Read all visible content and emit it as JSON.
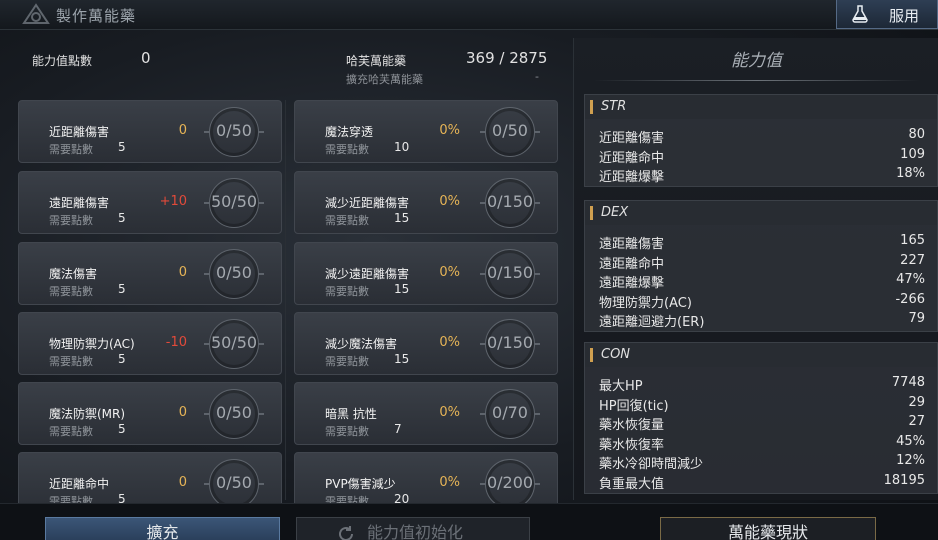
{
  "window": {
    "title": "製作萬能藥",
    "use_button": "服用",
    "title_icon": "emblem-icon",
    "use_icon": "potion-icon"
  },
  "left": {
    "points_label": "能力值點數",
    "points_value": "0",
    "potion_label": "哈芙萬能藥",
    "potion_value": "369 / 2875",
    "expand_label": "擴充哈芙萬能藥",
    "expand_value": "-"
  },
  "skills_left": [
    {
      "name": "近距離傷害",
      "req_label": "需要點數",
      "req": "5",
      "bonus": "0",
      "bonus_color": "gold",
      "count": "0/50"
    },
    {
      "name": "遠距離傷害",
      "req_label": "需要點數",
      "req": "5",
      "bonus": "+10",
      "bonus_color": "red",
      "count": "50/50"
    },
    {
      "name": "魔法傷害",
      "req_label": "需要點數",
      "req": "5",
      "bonus": "0",
      "bonus_color": "gold",
      "count": "0/50"
    },
    {
      "name": "物理防禦力(AC)",
      "req_label": "需要點數",
      "req": "5",
      "bonus": "-10",
      "bonus_color": "red",
      "count": "50/50"
    },
    {
      "name": "魔法防禦(MR)",
      "req_label": "需要點數",
      "req": "5",
      "bonus": "0",
      "bonus_color": "gold",
      "count": "0/50"
    },
    {
      "name": "近距離命中",
      "req_label": "需要點數",
      "req": "5",
      "bonus": "0",
      "bonus_color": "gold",
      "count": "0/50"
    }
  ],
  "skills_right": [
    {
      "name": "魔法穿透",
      "req_label": "需要點數",
      "req": "10",
      "bonus": "0%",
      "bonus_color": "gold",
      "count": "0/50"
    },
    {
      "name": "減少近距離傷害",
      "req_label": "需要點數",
      "req": "15",
      "bonus": "0%",
      "bonus_color": "gold",
      "count": "0/150"
    },
    {
      "name": "減少遠距離傷害",
      "req_label": "需要點數",
      "req": "15",
      "bonus": "0%",
      "bonus_color": "gold",
      "count": "0/150"
    },
    {
      "name": "減少魔法傷害",
      "req_label": "需要點數",
      "req": "15",
      "bonus": "0%",
      "bonus_color": "gold",
      "count": "0/150"
    },
    {
      "name": "暗黑 抗性",
      "req_label": "需要點數",
      "req": "7",
      "bonus": "0%",
      "bonus_color": "gold",
      "count": "0/70"
    },
    {
      "name": "PVP傷害減少",
      "req_label": "需要點數",
      "req": "20",
      "bonus": "0%",
      "bonus_color": "gold",
      "count": "0/200"
    }
  ],
  "right": {
    "title": "能力值",
    "groups": [
      {
        "name": "STR",
        "stats": [
          {
            "name": "近距離傷害",
            "value": "80"
          },
          {
            "name": "近距離命中",
            "value": "109"
          },
          {
            "name": "近距離爆擊",
            "value": "18%"
          }
        ]
      },
      {
        "name": "DEX",
        "stats": [
          {
            "name": "遠距離傷害",
            "value": "165"
          },
          {
            "name": "遠距離命中",
            "value": "227"
          },
          {
            "name": "遠距離爆擊",
            "value": "47%"
          },
          {
            "name": "物理防禦力(AC)",
            "value": "-266"
          },
          {
            "name": "遠距離迴避力(ER)",
            "value": "79"
          }
        ]
      },
      {
        "name": "CON",
        "stats": [
          {
            "name": "最大HP",
            "value": "7748"
          },
          {
            "name": "HP回復(tic)",
            "value": "29"
          },
          {
            "name": "藥水恢復量",
            "value": "27"
          },
          {
            "name": "藥水恢復率",
            "value": "45%"
          },
          {
            "name": "藥水冷卻時間減少",
            "value": "12%"
          },
          {
            "name": "負重最大值",
            "value": "18195"
          }
        ]
      }
    ]
  },
  "buttons": {
    "expand": "擴充",
    "reset": "能力值初始化",
    "status": "萬能藥現狀",
    "reset_icon": "refresh-icon"
  },
  "colors": {
    "accent_gold": "#e6b456",
    "accent_red": "#e24a3a",
    "button_blue": "#3b5677"
  }
}
